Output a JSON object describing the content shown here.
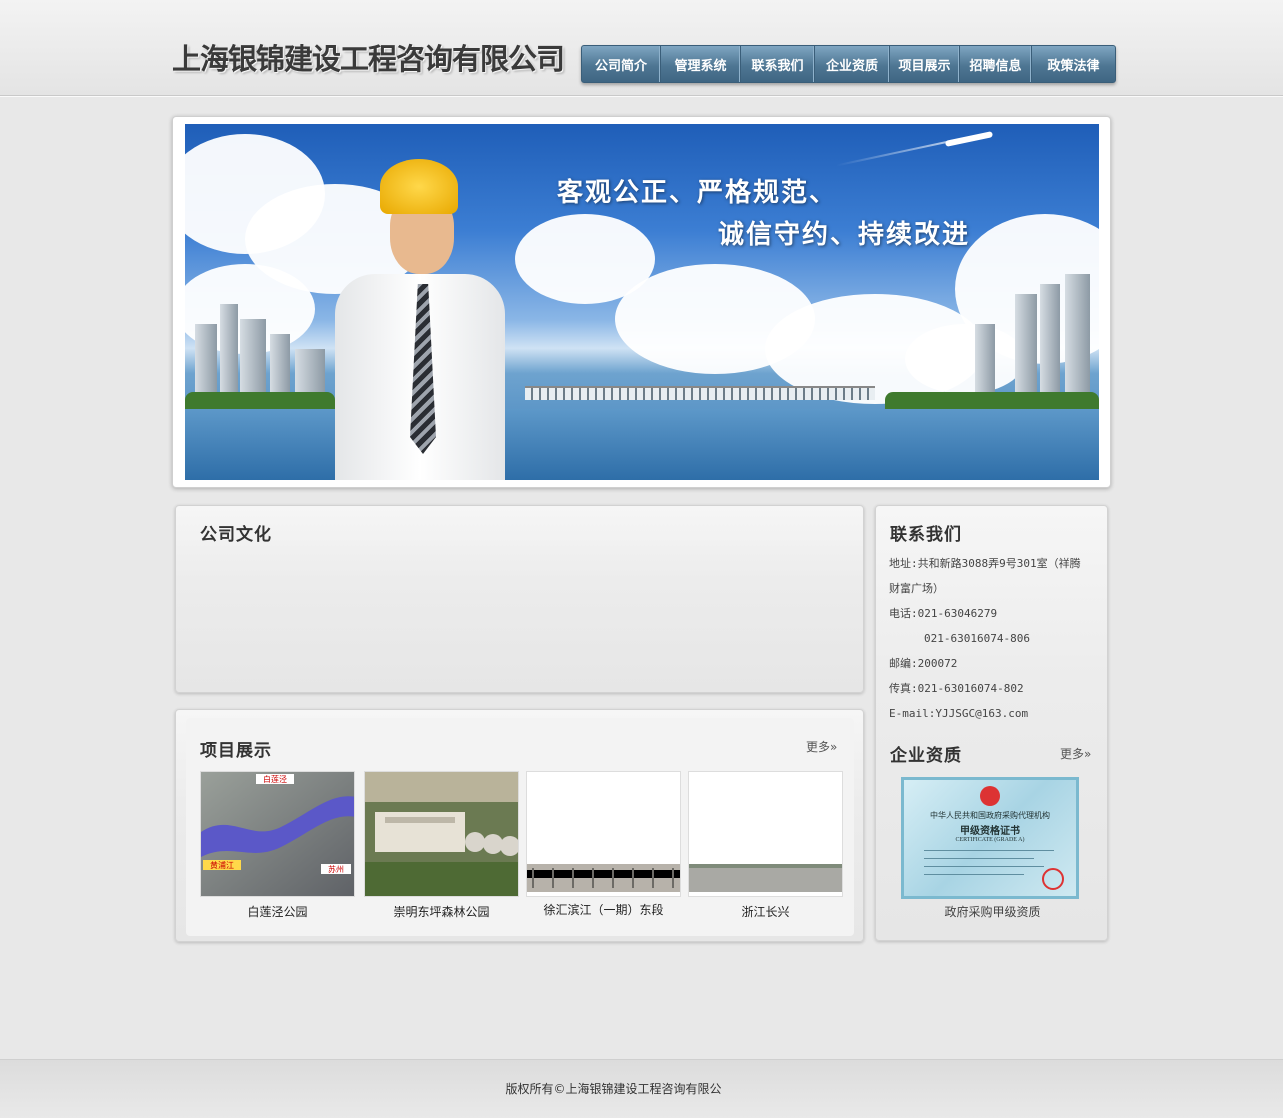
{
  "header": {
    "logo_text": "上海银锦建设工程咨询有限公司",
    "nav": [
      "公司简介",
      "管理系统",
      "联系我们",
      "企业资质",
      "项目展示",
      "招聘信息",
      "政策法律"
    ]
  },
  "banner": {
    "slogan_line1": "客观公正、严格规范、",
    "slogan_line2": "诚信守约、持续改进"
  },
  "culture": {
    "title": "公司文化"
  },
  "projects": {
    "title": "项目展示",
    "more": "更多»",
    "items": [
      {
        "caption": "白莲泾公园"
      },
      {
        "caption": "崇明东坪森林公园"
      },
      {
        "caption": "徐汇滨江（一期）东段"
      },
      {
        "caption": "浙江长兴"
      }
    ],
    "map_labels": [
      "白莲泾",
      "黄浦江",
      "苏州"
    ]
  },
  "contact": {
    "title": "联系我们",
    "address_label": "地址:",
    "address": "共和新路3088弄9号301室（祥腾",
    "address_cont": "财富广场）",
    "phone_label": "电话:",
    "phone1": "021-63046279",
    "phone2": "021-63016074-806",
    "zip_label": "邮编:",
    "zip": "200072",
    "fax_label": "传真:",
    "fax": "021-63016074-802",
    "email": "E-mail:YJJSGC@163.com"
  },
  "qualification": {
    "title": "企业资质",
    "more": "更多»",
    "cert_line1": "中华人民共和国政府采购代理机构",
    "cert_line2": "甲级资格证书",
    "cert_line3": "CERTIFICATE (GRADE A)",
    "caption": "政府采购甲级资质"
  },
  "footer": {
    "copyright": "版权所有©上海银锦建设工程咨询有限公"
  },
  "colors": {
    "nav_top": "#7fa6c2",
    "nav_bottom": "#3f6683",
    "page_bg": "#e8e8e8",
    "helmet": "#f5c518"
  }
}
